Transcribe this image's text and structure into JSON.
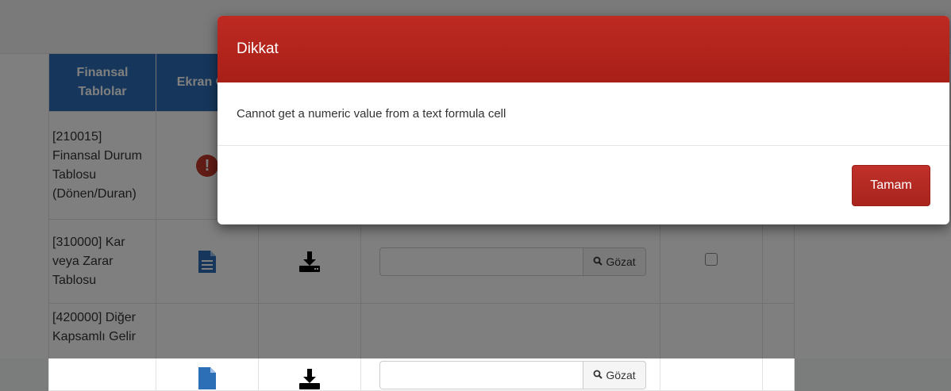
{
  "table": {
    "headers": {
      "finansal_tablolar": "Finansal Tablolar",
      "ekran_girisi_partial": "Ekran Giri"
    },
    "rows": [
      {
        "name": "[210015] Finansal Durum Tablosu (Dönen/Duran)",
        "status_icon": "error-icon"
      },
      {
        "name": "[310000] Kar veya Zarar Tablosu",
        "status_icon": "document-icon",
        "browse_label": "Gözat"
      },
      {
        "name": "[420000] Diğer Kapsamlı Gelir",
        "status_icon": "document-icon",
        "browse_label": "Gözat"
      }
    ],
    "error_glyph": "!"
  },
  "modal": {
    "title": "Dikkat",
    "message": "Cannot get a numeric value from a text formula cell",
    "ok_label": "Tamam"
  },
  "colors": {
    "modal_header": "#b2231c",
    "table_header": "#2d6fb6",
    "ok_button": "#b2281f"
  }
}
